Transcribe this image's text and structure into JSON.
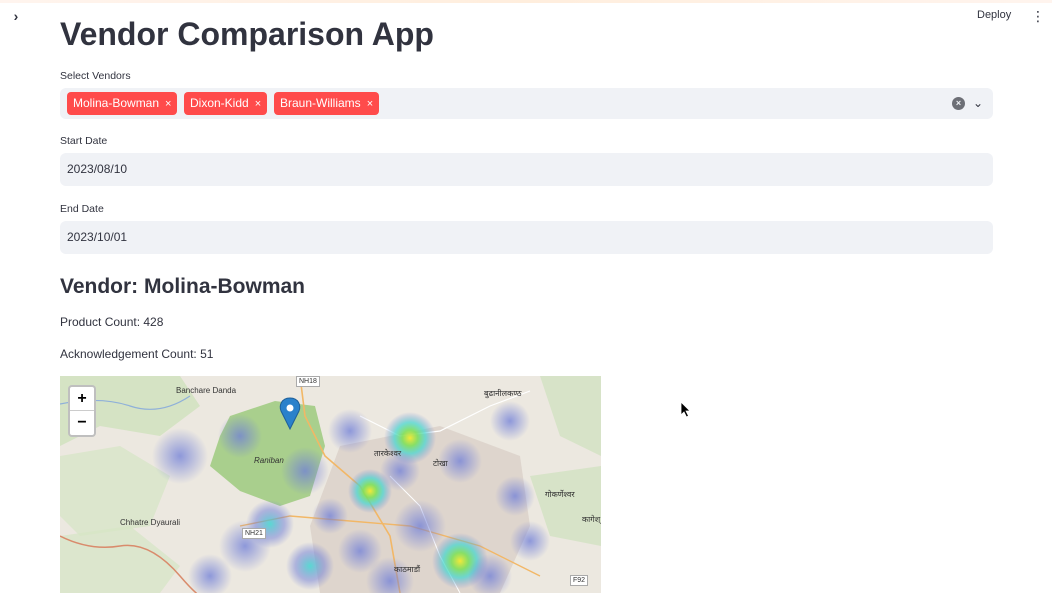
{
  "header": {
    "deploy_label": "Deploy",
    "sidebar_toggle_glyph": "›",
    "menu_glyph": "⋮"
  },
  "app": {
    "title": "Vendor Comparison App"
  },
  "vendors_select": {
    "label": "Select Vendors",
    "selected": [
      "Molina-Bowman",
      "Dixon-Kidd",
      "Braun-Williams"
    ],
    "remove_glyph": "×",
    "clear_glyph": "×",
    "dropdown_glyph": "⌄"
  },
  "start_date": {
    "label": "Start Date",
    "value": "2023/08/10"
  },
  "end_date": {
    "label": "End Date",
    "value": "2023/10/01"
  },
  "vendor_section": {
    "heading": "Vendor: Molina-Bowman",
    "product_count": "Product Count: 428",
    "acknowledgement_count": "Acknowledgement Count: 51"
  },
  "map": {
    "zoom_in": "+",
    "zoom_out": "−",
    "labels": {
      "banchare_danda": "Banchare Danda",
      "nh18": "NH18",
      "budhanilkantha": "बुढानीलकण्ठ",
      "raniban": "Raniban",
      "tarakeshwar": "तारकेश्वर",
      "tokha": "टोखा",
      "chhatre_dyaurali": "Chhatre Dyaurali",
      "nh21": "NH21",
      "kathmandu": "काठमाडौं",
      "gokarneshwar": "गोकर्णेश्वर",
      "f92": "F92",
      "kageshwari": "कागेश्"
    },
    "colors": {
      "base": "#eae6df",
      "forest": "#b9d7a0",
      "urban": "#d9d0c9",
      "river": "#7fa6d6",
      "road": "#f7c27b",
      "heat_low": "#6e7dd8",
      "heat_mid": "#3fd6d0",
      "heat_high": "#e8f03a",
      "marker": "#2a81cb"
    }
  },
  "theme": {
    "tag_color": "#ff4b4b",
    "input_bg": "#f0f2f6",
    "text": "#31333f"
  }
}
